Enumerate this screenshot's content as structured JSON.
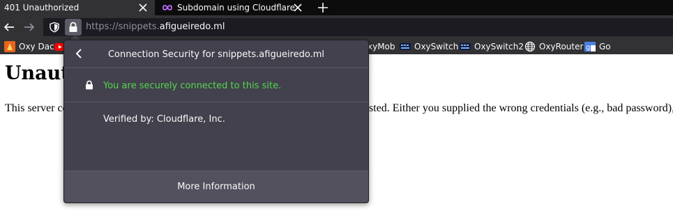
{
  "tabs": [
    {
      "title": "401 Unauthorized",
      "active": true
    },
    {
      "title": "Subdomain using Cloudflare - A",
      "active": false
    }
  ],
  "urlbar": {
    "scheme_sub": "https://snippets.",
    "domain": "afigueiredo.ml"
  },
  "bookmarks": [
    {
      "label": "Oxy Dac",
      "icon": "oxy-dac-icon"
    },
    {
      "label": "xyMob",
      "icon": "oxymob-icon"
    },
    {
      "label": "OxySwitch",
      "icon": "oxyswitch-icon"
    },
    {
      "label": "OxySwitch2",
      "icon": "oxyswitch-icon"
    },
    {
      "label": "OxyRouter",
      "icon": "globe-icon"
    },
    {
      "label": "Go",
      "icon": "google-icon"
    }
  ],
  "page": {
    "heading": "Unaut",
    "paragraph_left": "This server co",
    "paragraph_right": "sted. Either you supplied the wrong credentials (e.g., bad password),"
  },
  "panel": {
    "title": "Connection Security for snippets.afigueiredo.ml",
    "secure_text": "You are securely connected to this site.",
    "verified_by": "Verified by: Cloudflare, Inc.",
    "more_info": "More Information"
  },
  "colors": {
    "secure_green": "#56d84f",
    "panel_bg": "#42414d",
    "toolbar_bg": "#323234"
  }
}
